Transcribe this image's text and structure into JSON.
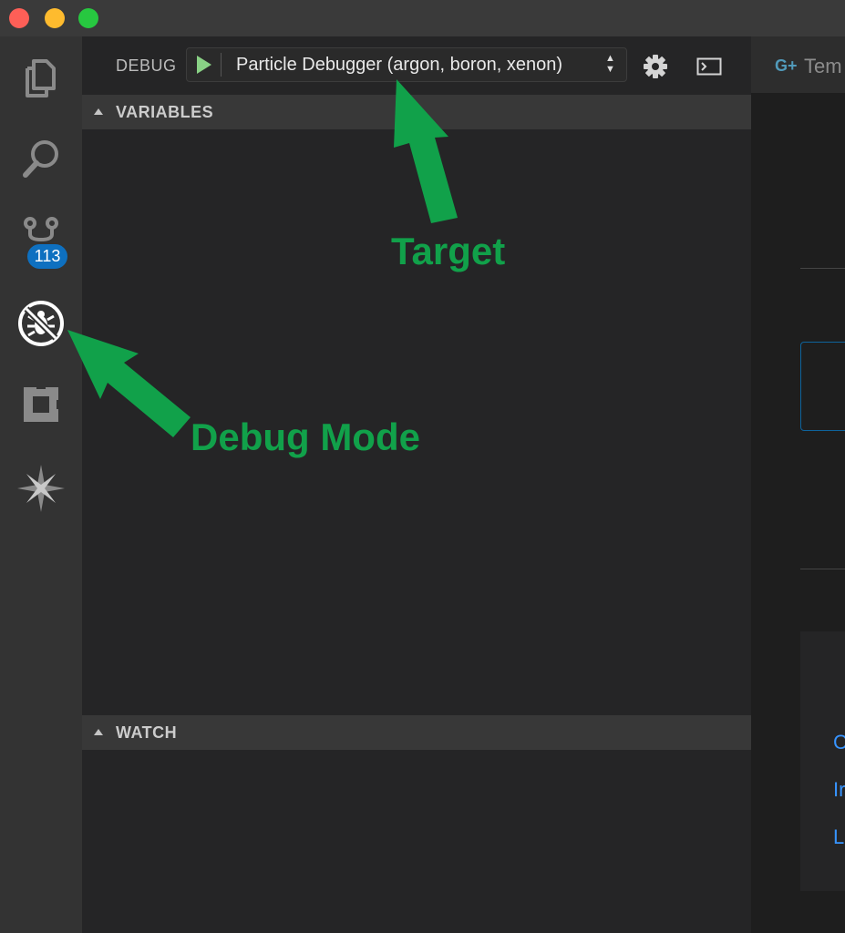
{
  "debug_toolbar": {
    "label": "DEBUG",
    "configuration": "Particle Debugger (argon, boron, xenon)"
  },
  "activity_bar": {
    "items": [
      {
        "icon": "files-icon"
      },
      {
        "icon": "search-icon"
      },
      {
        "icon": "source-control-icon",
        "badge": "113"
      },
      {
        "icon": "debug-icon",
        "active": true
      },
      {
        "icon": "extensions-icon"
      },
      {
        "icon": "particle-icon"
      }
    ]
  },
  "sections": {
    "variables": "VARIABLES",
    "watch": "WATCH"
  },
  "editor": {
    "tab_label": "Tem",
    "links": [
      "C",
      "Ir",
      "L"
    ]
  },
  "annotations": {
    "target": "Target",
    "debug_mode": "Debug Mode"
  },
  "colors": {
    "annotation": "#11a14a",
    "badge": "#0e70c0",
    "play": "#89d185",
    "link": "#3794ff"
  }
}
